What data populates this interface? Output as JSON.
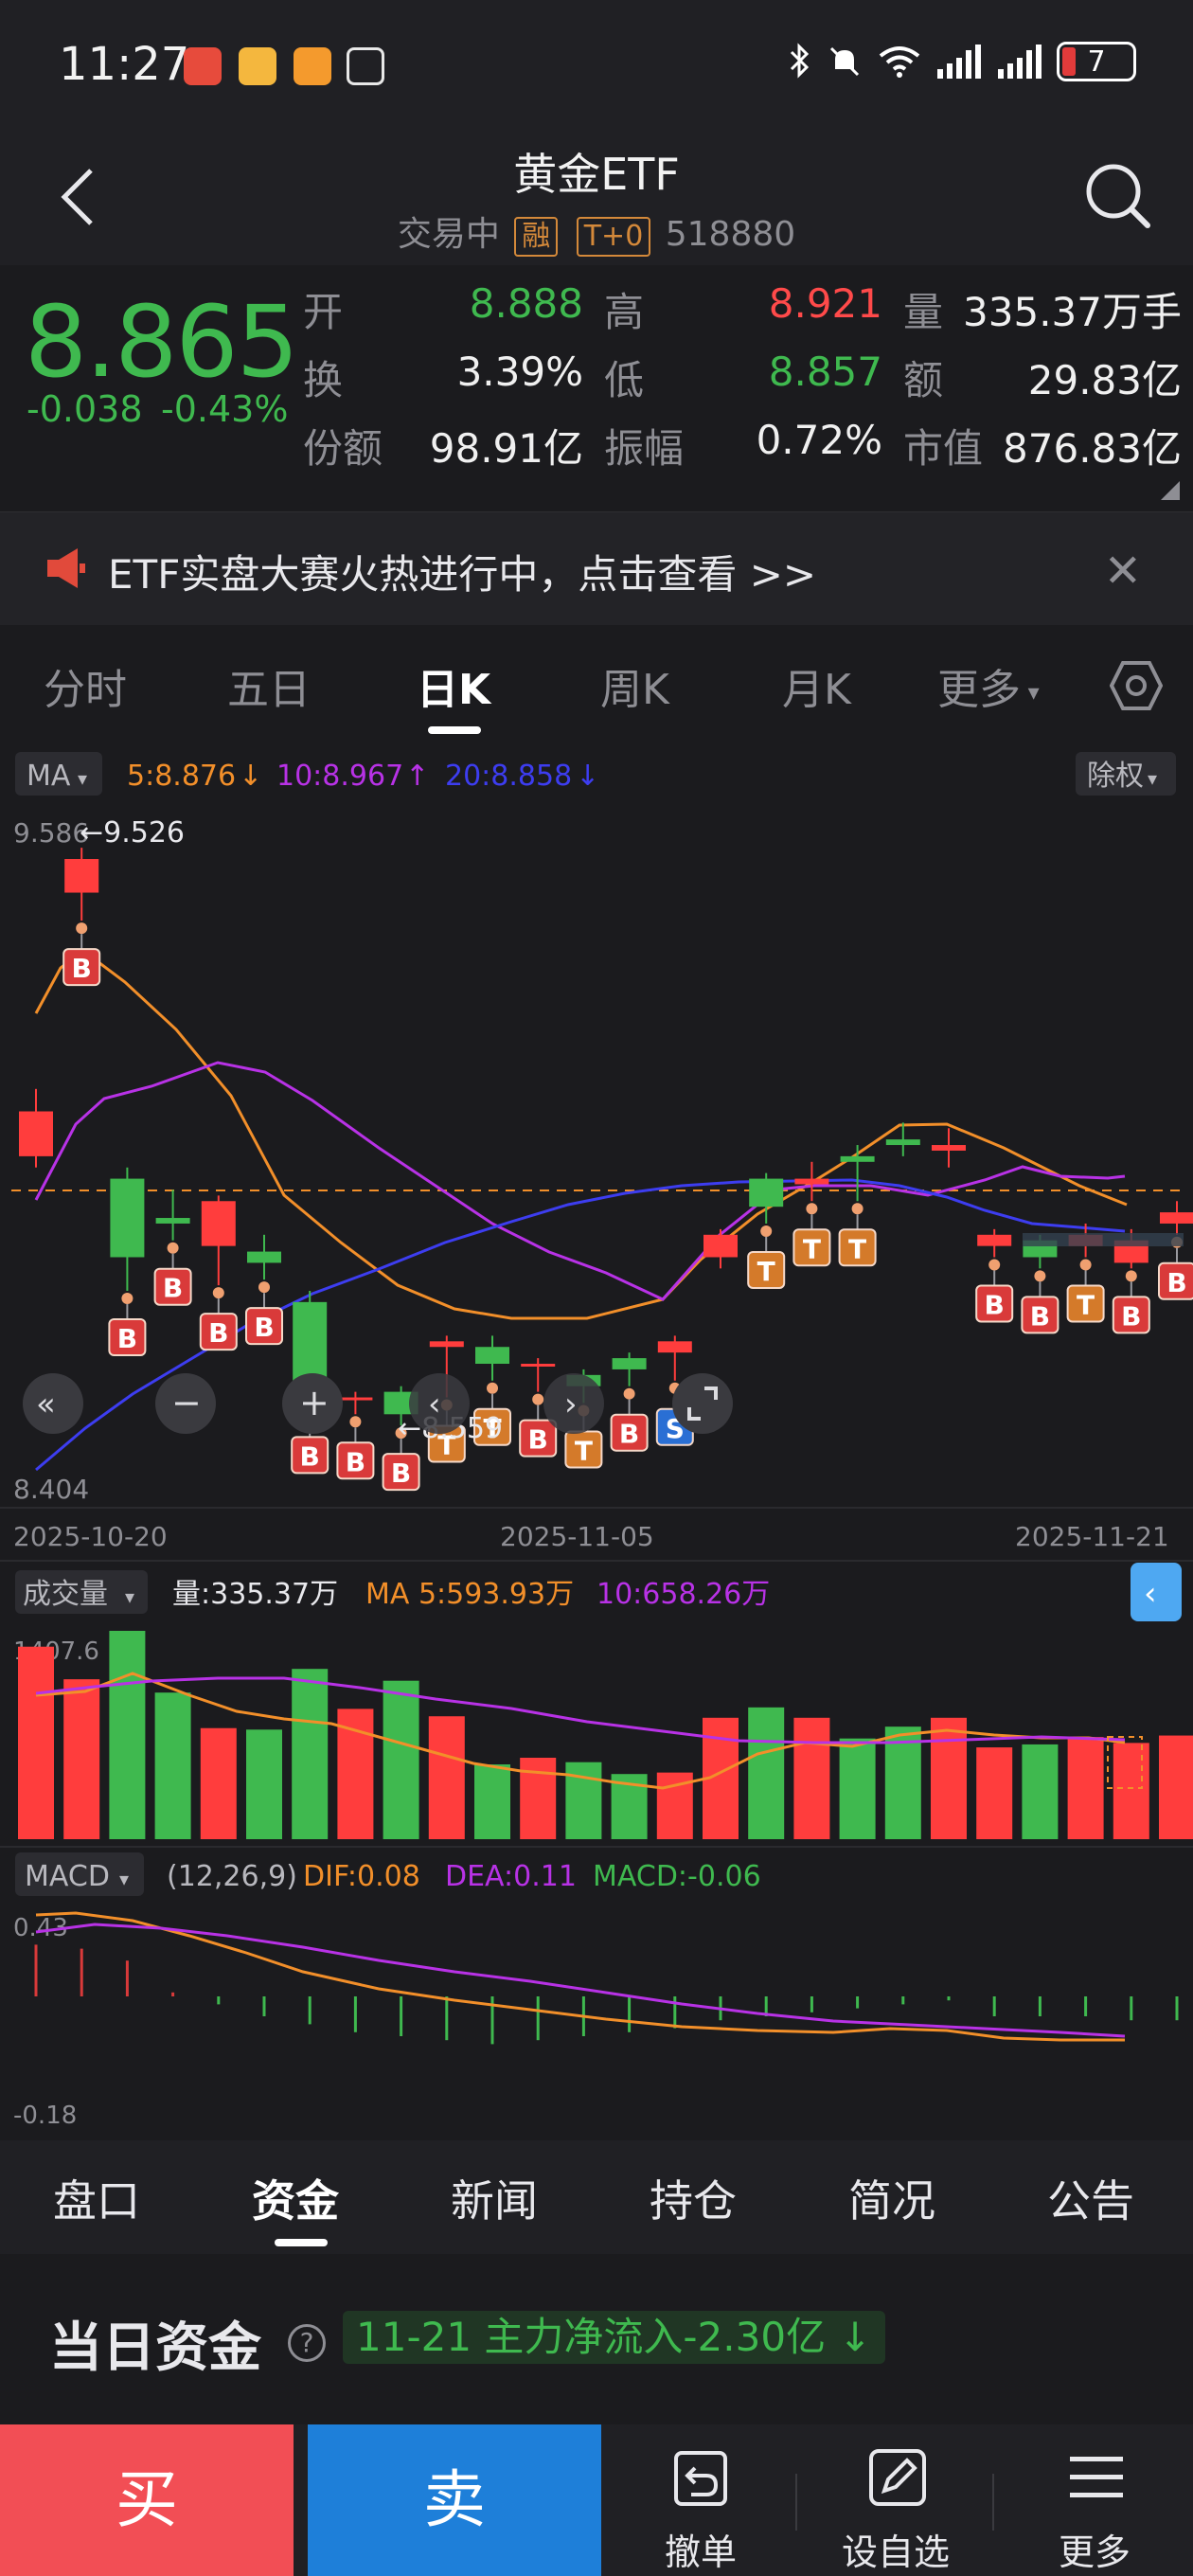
{
  "status_bar": {
    "time": "11:27",
    "battery": "7"
  },
  "header": {
    "title": "黄金ETF",
    "trading_state": "交易中",
    "tag_margin": "融",
    "tag_t0": "T+0",
    "code": "518880"
  },
  "quote": {
    "price": "8.865",
    "change": "-0.038",
    "change_pct": "-0.43%",
    "fields": [
      {
        "label": "开",
        "value": "8.888",
        "color": "#3fb94f"
      },
      {
        "label": "高",
        "value": "8.921",
        "color": "#ff4a4a"
      },
      {
        "label": "量",
        "value": "335.37万手",
        "color": "#f0f0f0"
      },
      {
        "label": "换",
        "value": "3.39%",
        "color": "#f0f0f0"
      },
      {
        "label": "低",
        "value": "8.857",
        "color": "#3fb94f"
      },
      {
        "label": "额",
        "value": "29.83亿",
        "color": "#f0f0f0"
      },
      {
        "label": "份额",
        "value": "98.91亿",
        "color": "#f0f0f0"
      },
      {
        "label": "振幅",
        "value": "0.72%",
        "color": "#f0f0f0"
      },
      {
        "label": "市值",
        "value": "876.83亿",
        "color": "#f0f0f0"
      }
    ]
  },
  "banner": {
    "text": "ETF实盘大赛火热进行中，点击查看 >>"
  },
  "kline_tabs": [
    "分时",
    "五日",
    "日K",
    "周K",
    "月K",
    "更多"
  ],
  "kline_active": "日K",
  "chart_controls": {
    "ma_select": "MA",
    "ma5": "5:8.876",
    "ma10": "10:8.967",
    "ma20": "20:8.858",
    "adjust": "除权",
    "price_top": "9.586",
    "price_bottom": "8.404",
    "high_label": "←9.526",
    "low_label": "←8.559",
    "dates": [
      "2025-10-20",
      "2025-11-05",
      "2025-11-21"
    ],
    "vol_select": "成交量",
    "vol_text": "量:335.37万",
    "vol_ma5": "MA 5:593.93万",
    "vol_ma10": "10:658.26万",
    "vol_top": "1407.6",
    "macd_select": "MACD",
    "macd_params": "(12,26,9)",
    "dif": "DIF:0.08",
    "dea": "DEA:0.11",
    "macd": "MACD:-0.06",
    "macd_top": "0.43",
    "macd_bottom": "-0.18"
  },
  "chart_data": {
    "type": "candlestick",
    "dates_first": "2025-10-20",
    "dates_last": "2025-11-21",
    "ylim": [
      8.404,
      9.586
    ],
    "candles": [
      {
        "o": 8.98,
        "c": 9.06,
        "h": 9.1,
        "l": 8.96
      },
      {
        "o": 9.45,
        "c": 9.51,
        "h": 9.53,
        "l": 9.4
      },
      {
        "o": 8.94,
        "c": 8.8,
        "h": 8.96,
        "l": 8.74
      },
      {
        "o": 8.87,
        "c": 8.86,
        "h": 8.92,
        "l": 8.83
      },
      {
        "o": 8.82,
        "c": 8.9,
        "h": 8.91,
        "l": 8.75
      },
      {
        "o": 8.81,
        "c": 8.79,
        "h": 8.84,
        "l": 8.76
      },
      {
        "o": 8.72,
        "c": 8.55,
        "h": 8.74,
        "l": 8.53
      },
      {
        "o": 8.55,
        "c": 8.55,
        "h": 8.56,
        "l": 8.52
      },
      {
        "o": 8.56,
        "c": 8.52,
        "h": 8.57,
        "l": 8.5
      },
      {
        "o": 8.64,
        "c": 8.65,
        "h": 8.66,
        "l": 8.55
      },
      {
        "o": 8.64,
        "c": 8.61,
        "h": 8.66,
        "l": 8.58
      },
      {
        "o": 8.61,
        "c": 8.61,
        "h": 8.62,
        "l": 8.56
      },
      {
        "o": 8.59,
        "c": 8.57,
        "h": 8.6,
        "l": 8.54
      },
      {
        "o": 8.62,
        "c": 8.6,
        "h": 8.63,
        "l": 8.57
      },
      {
        "o": 8.63,
        "c": 8.65,
        "h": 8.66,
        "l": 8.58
      },
      {
        "o": 8.8,
        "c": 8.84,
        "h": 8.85,
        "l": 8.78
      },
      {
        "o": 8.94,
        "c": 8.89,
        "h": 8.95,
        "l": 8.86
      },
      {
        "o": 8.93,
        "c": 8.94,
        "h": 8.97,
        "l": 8.9
      },
      {
        "o": 8.98,
        "c": 8.97,
        "h": 9.0,
        "l": 8.9
      },
      {
        "o": 9.01,
        "c": 9.0,
        "h": 9.04,
        "l": 8.98
      },
      {
        "o": 8.99,
        "c": 9.0,
        "h": 9.03,
        "l": 8.96
      },
      {
        "o": 8.82,
        "c": 8.84,
        "h": 8.85,
        "l": 8.8
      },
      {
        "o": 8.83,
        "c": 8.8,
        "h": 8.84,
        "l": 8.78
      },
      {
        "o": 8.82,
        "c": 8.84,
        "h": 8.86,
        "l": 8.8
      },
      {
        "o": 8.79,
        "c": 8.83,
        "h": 8.85,
        "l": 8.78
      },
      {
        "o": 8.86,
        "c": 8.88,
        "h": 8.9,
        "l": 8.84
      },
      {
        "o": 8.88,
        "c": 8.865,
        "h": 8.92,
        "l": 8.857
      }
    ],
    "volume": [
      1300,
      1080,
      1407,
      990,
      750,
      740,
      1150,
      880,
      1070,
      830,
      505,
      550,
      520,
      440,
      450,
      820,
      890,
      820,
      680,
      760,
      820,
      620,
      640,
      690,
      650,
      700,
      390
    ],
    "macd_bars": [
      0.13,
      0.12,
      0.09,
      0.01,
      -0.02,
      -0.05,
      -0.07,
      -0.09,
      -0.1,
      -0.11,
      -0.12,
      -0.11,
      -0.1,
      -0.09,
      -0.08,
      -0.06,
      -0.05,
      -0.04,
      -0.03,
      -0.02,
      -0.01,
      -0.05,
      -0.05,
      -0.05,
      -0.06,
      -0.06,
      -0.06
    ]
  },
  "bottom_tabs": [
    "盘口",
    "资金",
    "新闻",
    "持仓",
    "简况",
    "公告"
  ],
  "bottom_active": "资金",
  "fund": {
    "heading": "当日资金",
    "flow": "11-21 主力净流入-2.30亿"
  },
  "actions": {
    "buy": "买",
    "sell": "卖",
    "cancel": "撤单",
    "watch": "设自选",
    "more": "更多"
  }
}
